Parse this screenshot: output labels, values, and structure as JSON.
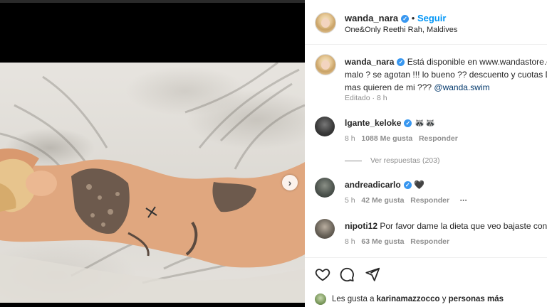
{
  "post": {
    "author": "wanda_nara",
    "follow_label": "Seguir",
    "location": "One&Only Reethi Rah, Maldives",
    "caption_lines": [
      "Está disponible en www.wandastore.c",
      "malo ? se agotan !!! lo bueno ?? descuento y cuotas D",
      "mas quieren de mi ??? "
    ],
    "caption_mention": "@wanda.swim",
    "caption_meta": "Editado · 8 h"
  },
  "comments": [
    {
      "user": "lgante_keloke",
      "text": "🦝🦝",
      "time": "8 h",
      "likes": "1088 Me gusta",
      "reply": "Responder",
      "replies_label": "Ver respuestas (203)"
    },
    {
      "user": "andreadicarlo",
      "text": "🖤",
      "time": "5 h",
      "likes": "42 Me gusta",
      "reply": "Responder",
      "more": "···"
    },
    {
      "user": "nipoti12",
      "text": "Por favor dame la dieta que veo bajaste con",
      "time": "8 h",
      "likes": "63 Me gusta",
      "reply": "Responder"
    }
  ],
  "footer": {
    "likes_prefix": "Les gusta a ",
    "liker": "karinamazzocco",
    "likes_suffix": " y ",
    "others": "personas más"
  },
  "icons": {
    "like": "heart-icon",
    "comment": "comment-icon",
    "share": "share-icon",
    "verified": "verified-icon",
    "next": "chevron-right-icon"
  },
  "colors": {
    "verified": "#3897f0",
    "follow": "#0095f6",
    "link": "#00376b",
    "meta": "#8e8e8e"
  }
}
